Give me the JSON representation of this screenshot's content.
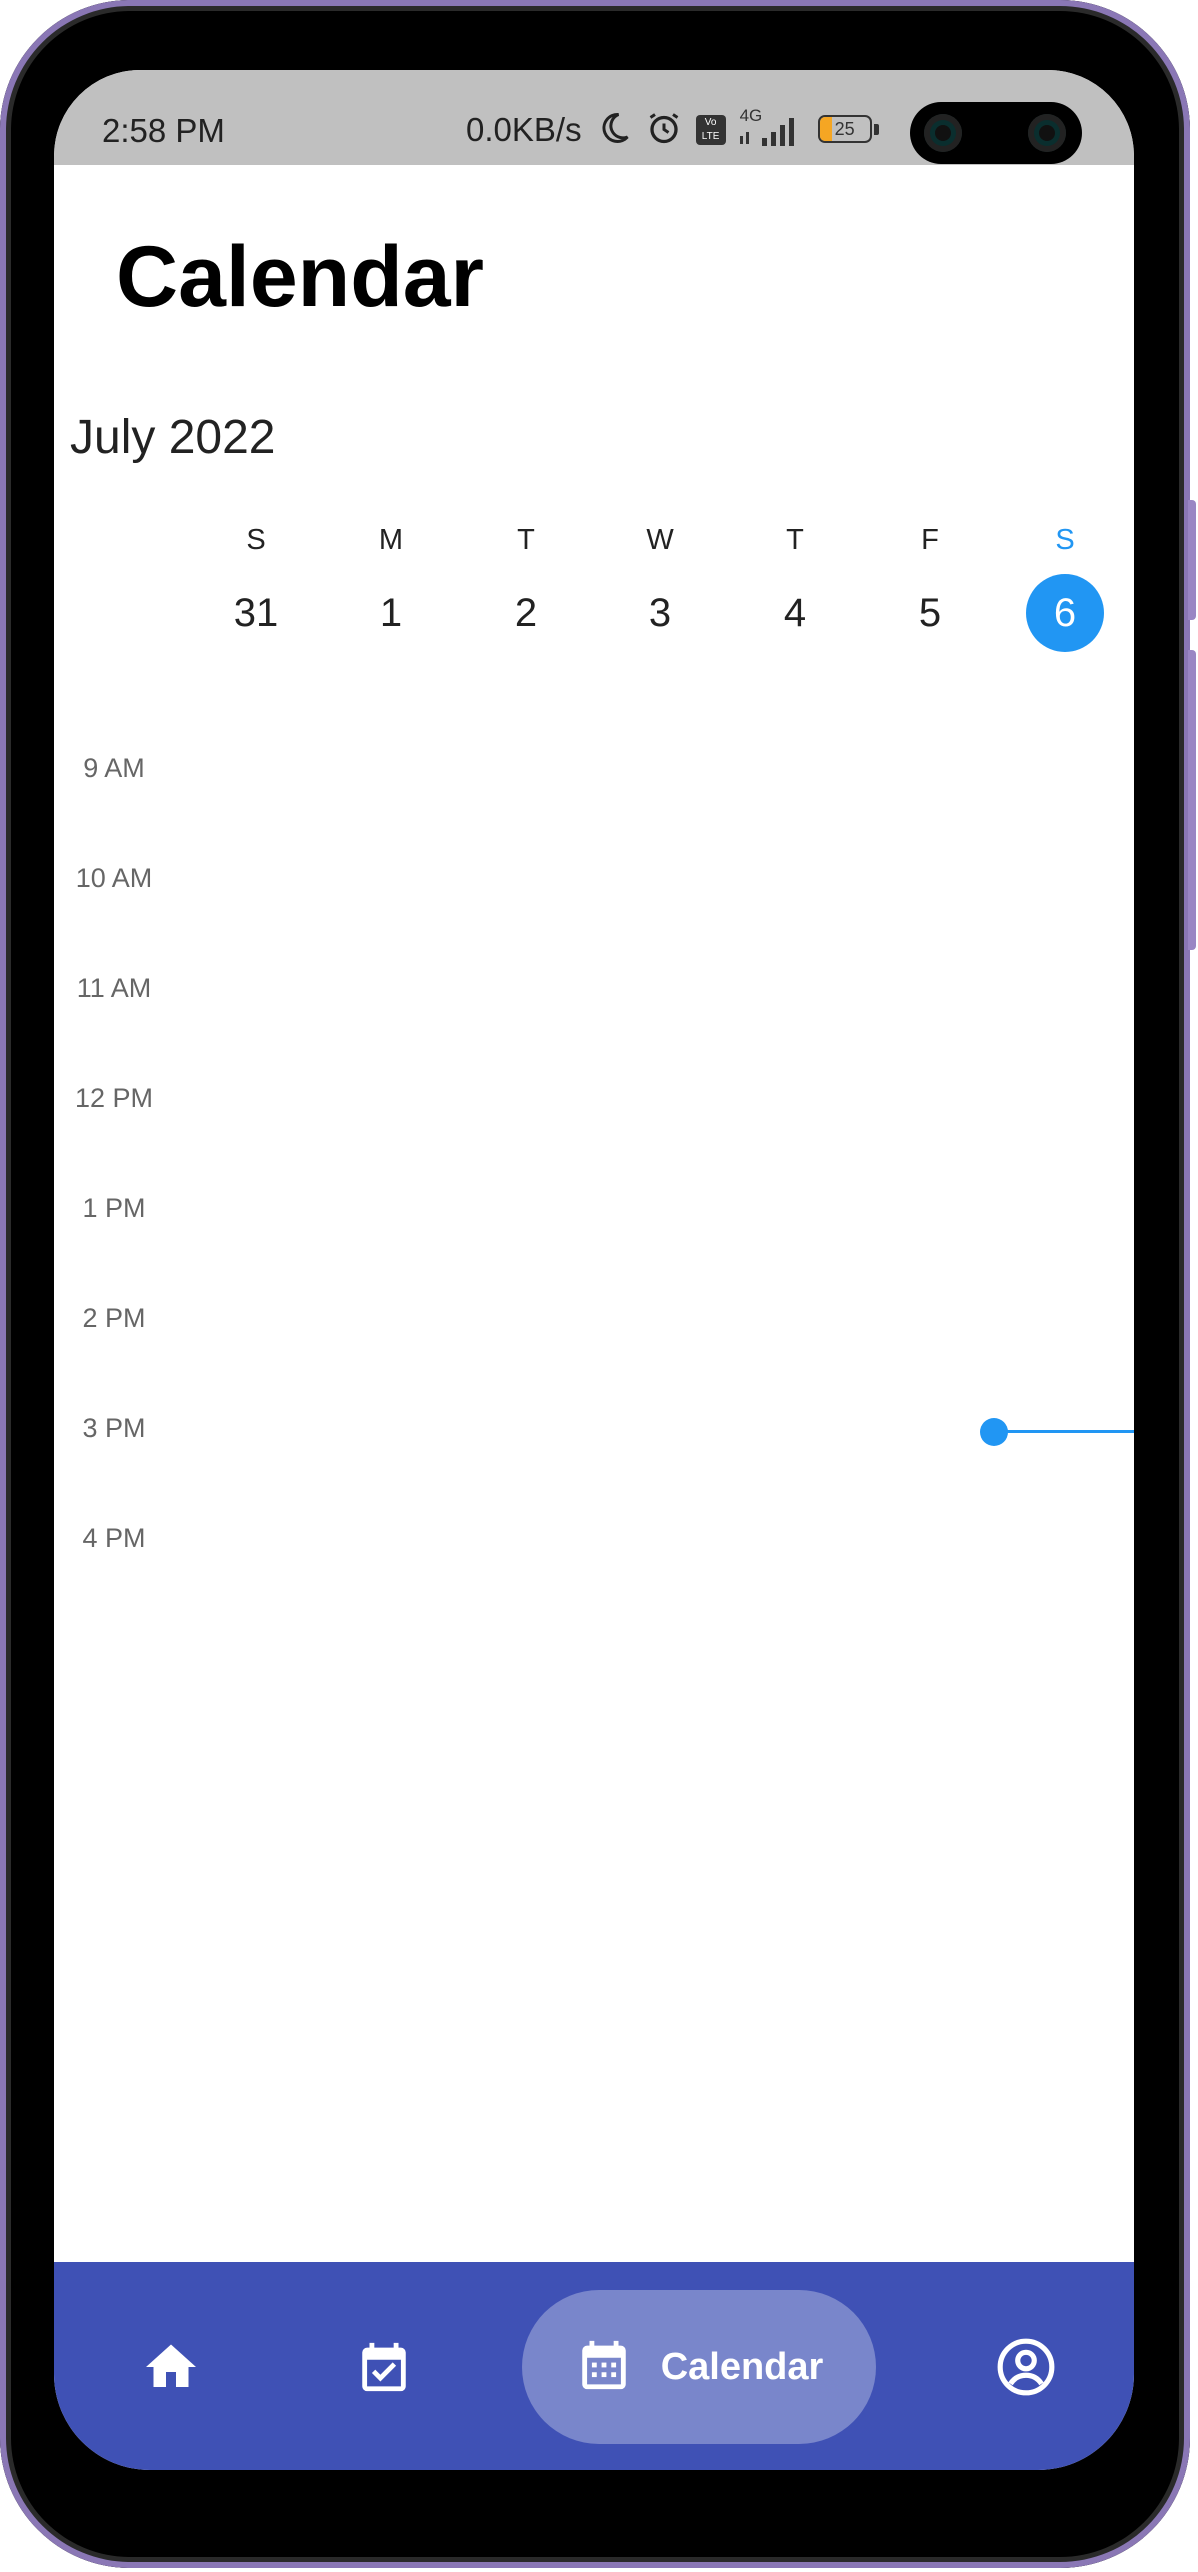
{
  "status_bar": {
    "time": "2:58 PM",
    "network_speed": "0.0KB/s",
    "volte": "Vo LTE",
    "signal_type": "4G",
    "battery": "25",
    "icons": [
      "moon-icon",
      "alarm-icon",
      "volte-icon",
      "signal-icon",
      "battery-icon"
    ]
  },
  "header": {
    "title": "Calendar"
  },
  "calendar": {
    "month_label": "July 2022",
    "week": [
      {
        "dow": "S",
        "day": "31",
        "selected": false
      },
      {
        "dow": "M",
        "day": "1",
        "selected": false
      },
      {
        "dow": "T",
        "day": "2",
        "selected": false
      },
      {
        "dow": "W",
        "day": "3",
        "selected": false
      },
      {
        "dow": "T",
        "day": "4",
        "selected": false
      },
      {
        "dow": "F",
        "day": "5",
        "selected": false
      },
      {
        "dow": "S",
        "day": "6",
        "selected": true
      }
    ],
    "hours": [
      "9 AM",
      "10 AM",
      "11 AM",
      "12 PM",
      "1 PM",
      "2 PM",
      "3 PM",
      "4 PM"
    ]
  },
  "bottom_nav": {
    "items": [
      {
        "icon": "home-icon",
        "label": "",
        "active": false
      },
      {
        "icon": "task-calendar-icon",
        "label": "",
        "active": false
      },
      {
        "icon": "calendar-icon",
        "label": "Calendar",
        "active": true
      },
      {
        "icon": "account-icon",
        "label": "",
        "active": false
      }
    ]
  },
  "colors": {
    "accent": "#2196F3",
    "nav_background": "#3F51B5",
    "nav_active_pill": "#7986CB",
    "status_bar": "#C0C0C0"
  }
}
